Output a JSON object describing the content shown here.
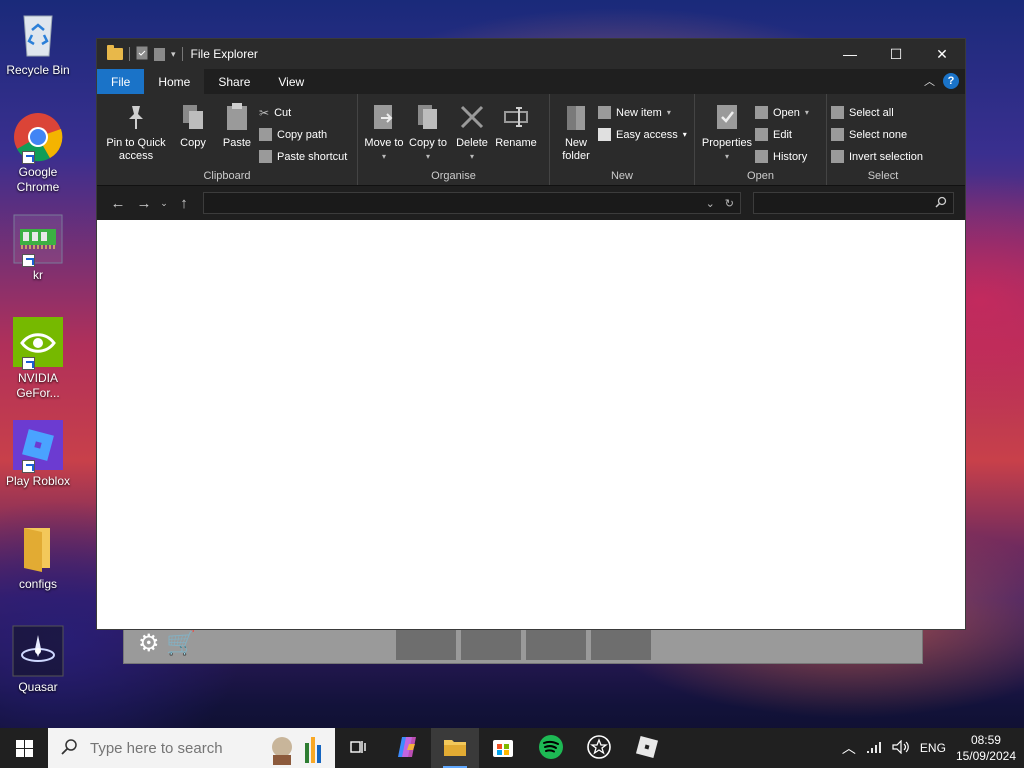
{
  "desktop": {
    "icons": [
      {
        "label": "Recycle Bin",
        "icon": "recycle-bin-icon"
      },
      {
        "label": "Google Chrome",
        "icon": "chrome-icon"
      },
      {
        "label": "kr",
        "icon": "ram-icon"
      },
      {
        "label": "NVIDIA GeFor...",
        "icon": "nvidia-icon"
      },
      {
        "label": "Play Roblox",
        "icon": "roblox-icon"
      },
      {
        "label": "configs",
        "icon": "folder-icon"
      },
      {
        "label": "Quasar",
        "icon": "quasar-icon"
      }
    ]
  },
  "window": {
    "title": "File Explorer",
    "controls": {
      "minimize": "—",
      "maximize": "☐",
      "close": "✕"
    },
    "tabs": [
      "File",
      "Home",
      "Share",
      "View"
    ],
    "active_tab": "Home",
    "help": "?",
    "ribbon": {
      "clipboard": {
        "name": "Clipboard",
        "pin": "Pin to Quick access",
        "copy": "Copy",
        "paste": "Paste",
        "cut": "Cut",
        "copy_path": "Copy path",
        "paste_shortcut": "Paste shortcut"
      },
      "organise": {
        "name": "Organise",
        "move_to": "Move to",
        "copy_to": "Copy to",
        "delete": "Delete",
        "rename": "Rename"
      },
      "new": {
        "name": "New",
        "new_folder": "New folder",
        "new_item": "New item",
        "easy_access": "Easy access"
      },
      "open": {
        "name": "Open",
        "properties": "Properties",
        "open": "Open",
        "edit": "Edit",
        "history": "History"
      },
      "select": {
        "name": "Select",
        "select_all": "Select all",
        "select_none": "Select none",
        "invert_selection": "Invert selection"
      }
    },
    "address": {
      "value": "",
      "search_placeholder": ""
    }
  },
  "taskbar": {
    "search_placeholder": "Type here to search",
    "language": "ENG",
    "time": "08:59",
    "date": "15/09/2024",
    "apps": [
      "task-view-icon",
      "copilot-icon",
      "file-explorer-icon",
      "microsoft-store-icon",
      "spotify-icon",
      "star-app-icon",
      "roblox-icon"
    ]
  },
  "colors": {
    "accent": "#1a73c8",
    "titlebar": "#2b2b2b",
    "ribbon": "#2b2b2b",
    "taskbar": "#202020"
  }
}
